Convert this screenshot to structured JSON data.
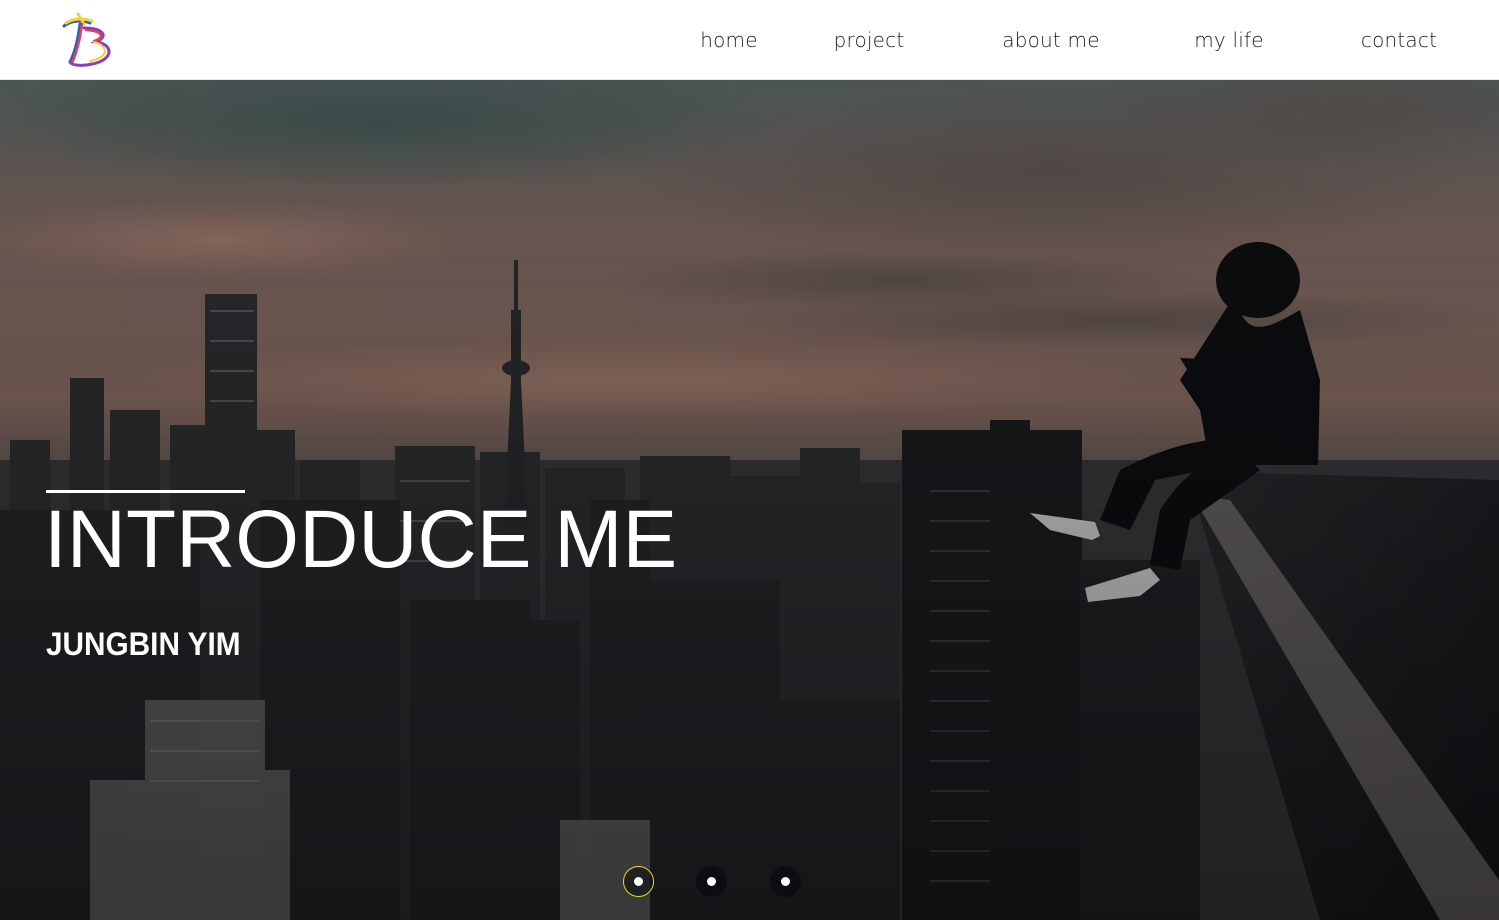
{
  "site": {
    "logo_alt": "JB logo",
    "logo_colors": [
      "#f3d23a",
      "#2e5fb8",
      "#e3405f",
      "#8b3fb3"
    ]
  },
  "nav": {
    "items": [
      {
        "label": "home"
      },
      {
        "label": "project"
      },
      {
        "label": "about me"
      },
      {
        "label": "my life"
      },
      {
        "label": "contact"
      }
    ]
  },
  "hero": {
    "title": "INTRODUCE ME",
    "subtitle": "JUNGBIN YIM",
    "background_image": "city skyline at dusk with a hooded person sitting on a rooftop ledge",
    "slides": {
      "count": 3,
      "active_index": 0,
      "active_ring_color": "#e5d43a"
    }
  }
}
